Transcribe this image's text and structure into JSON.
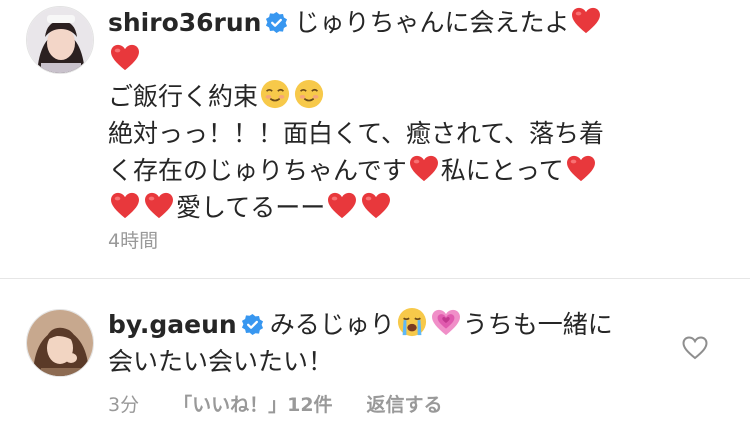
{
  "comments": [
    {
      "username": "shiro36run",
      "lines": [
        "じゅりちゃんに会えたよ",
        "ご飯行く約束",
        "絶対っっ！！！面白くて、癒されて、落ち着",
        "く存在のじゅりちゃんです",
        "私にとって",
        "愛してるーー"
      ],
      "time": "4時間"
    },
    {
      "username": "by.gaeun",
      "text_a": "みるじゅり",
      "text_b": "うちも一緒に",
      "text_c": "会いたい会いたい！",
      "time": "3分",
      "likes": "「いいね！」12件",
      "reply": "返信する"
    }
  ],
  "icons": {
    "verified": "verified-badge-icon",
    "heart": "red-heart-emoji",
    "smile": "smiling-face-emoji",
    "cry": "loudly-crying-face-emoji",
    "pink_heart": "growing-heart-emoji",
    "like": "heart-outline-icon"
  },
  "colors": {
    "verified": "#3897f0",
    "heart": "#e8383c",
    "meta": "#999999",
    "text": "#262626"
  }
}
